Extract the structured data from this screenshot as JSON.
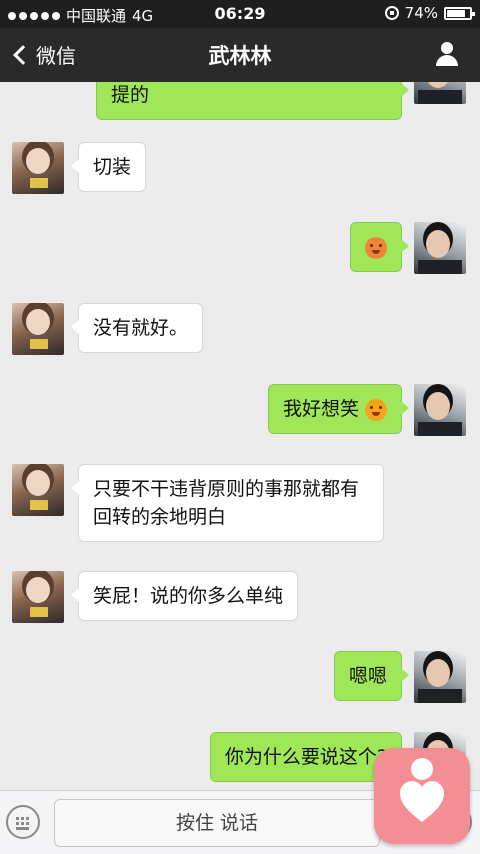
{
  "status_bar": {
    "carrier": "中国联通",
    "network": "4G",
    "time": "06:29",
    "battery": "74%"
  },
  "nav": {
    "back_label": "微信",
    "title": "武林林"
  },
  "messages": [
    {
      "side": "out",
      "text": "提的"
    },
    {
      "side": "in",
      "text": "切装"
    },
    {
      "side": "out",
      "text": "",
      "emoji": "blush-emoji"
    },
    {
      "side": "in",
      "text": "没有就好。"
    },
    {
      "side": "out",
      "text": "我好想笑",
      "emoji": "grin-emoji"
    },
    {
      "side": "in",
      "text": "只要不干违背原则的事那就都有回转的余地明白"
    },
    {
      "side": "in",
      "text": "笑屁！说的你多么单纯"
    },
    {
      "side": "out",
      "text": "嗯嗯"
    },
    {
      "side": "out",
      "text": "你为什么要说这个?"
    }
  ],
  "input_bar": {
    "hold_to_talk": "按住 说话"
  },
  "colors": {
    "nav_bg": "#2a2a2a",
    "chat_bg": "#ebebeb",
    "bubble_out": "#9fe658",
    "bubble_in": "#ffffff",
    "floating_app": "#f28e94"
  }
}
